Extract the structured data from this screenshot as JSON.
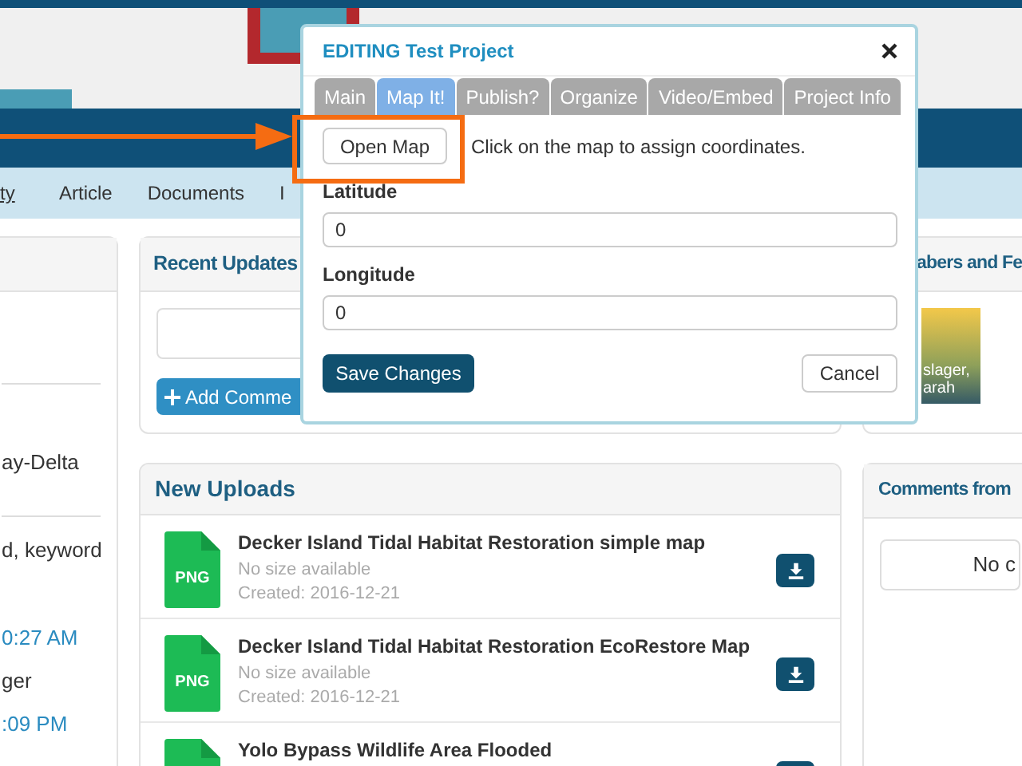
{
  "nav": {
    "items": [
      {
        "label": "ty",
        "selected": true
      },
      {
        "label": "Article",
        "selected": false
      },
      {
        "label": "Documents",
        "selected": false
      },
      {
        "label": "I",
        "selected": false
      }
    ]
  },
  "left_panel": {
    "sections": [
      {
        "lines": [
          {
            "text": "ay-Delta",
            "kind": "text"
          }
        ]
      },
      {
        "lines": [
          {
            "text": "d, keyword",
            "kind": "text"
          },
          {
            "text": "0:27 AM",
            "kind": "link"
          },
          {
            "text": "ger",
            "kind": "text"
          },
          {
            "text": ":09 PM",
            "kind": "link"
          }
        ]
      }
    ]
  },
  "recent_updates": {
    "title": "Recent Updates",
    "add_button": "Add Comme"
  },
  "new_uploads": {
    "title": "New Uploads",
    "files": [
      {
        "type": "PNG",
        "title": "Decker Island Tidal Habitat Restoration simple map",
        "size": "No size available",
        "created": "Created: 2016-12-21"
      },
      {
        "type": "PNG",
        "title": "Decker Island Tidal Habitat Restoration EcoRestore Map",
        "size": "No size available",
        "created": "Created: 2016-12-21"
      },
      {
        "title": "Yolo Bypass Wildlife Area Flooded"
      }
    ]
  },
  "members": {
    "title": "abers and Fe",
    "member_name": [
      "slager,",
      "arah"
    ]
  },
  "comments": {
    "title": "Comments from",
    "empty": "No c"
  },
  "modal": {
    "title": "EDITING Test Project",
    "tabs": [
      {
        "label": "Main",
        "selected": false
      },
      {
        "label": "Map It!",
        "selected": true
      },
      {
        "label": "Publish?",
        "selected": false
      },
      {
        "label": "Organize",
        "selected": false
      },
      {
        "label": "Video/Embed",
        "selected": false
      },
      {
        "label": "Project Info",
        "selected": false
      }
    ],
    "open_map": "Open Map",
    "hint": "Click on the map to assign coordinates.",
    "fields": [
      {
        "label": "Latitude",
        "value": "0"
      },
      {
        "label": "Longitude",
        "value": "0"
      }
    ],
    "save": "Save Changes",
    "cancel": "Cancel"
  }
}
